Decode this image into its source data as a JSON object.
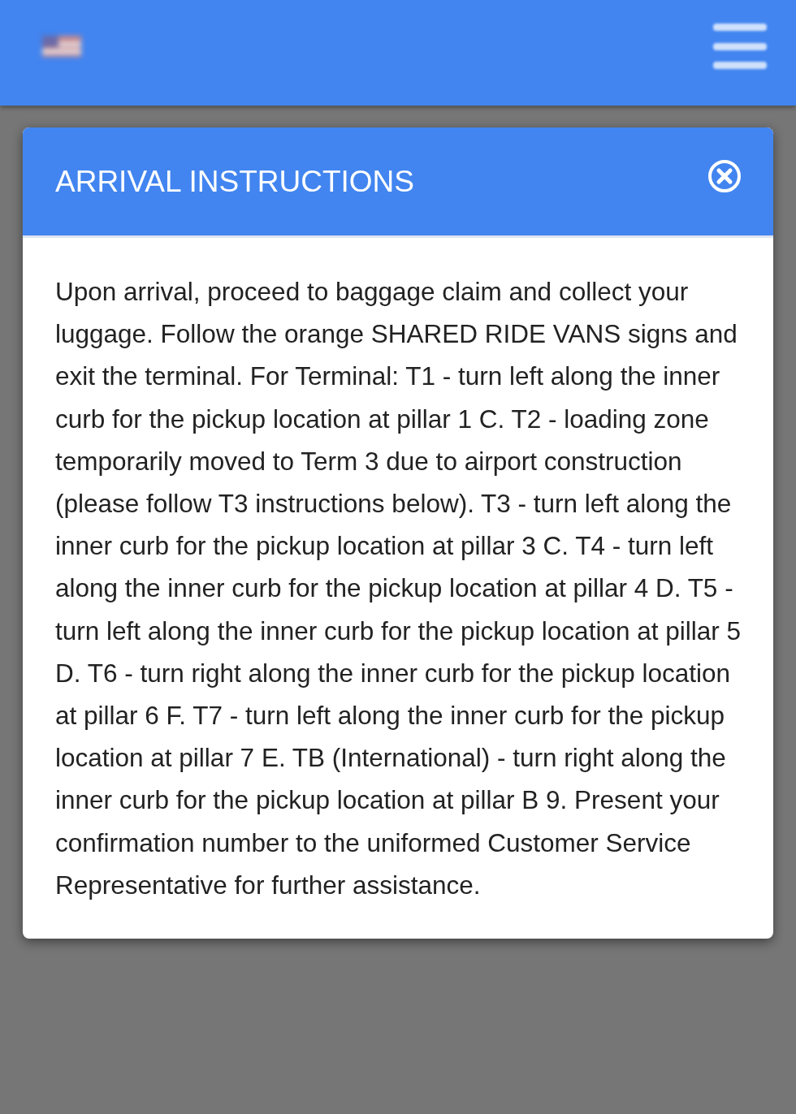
{
  "modal": {
    "title": "ARRIVAL INSTRUCTIONS",
    "body": "Upon arrival, proceed to baggage claim and collect your luggage. Follow the orange SHARED RIDE VANS signs and exit the terminal. For Terminal: T1 - turn left along the inner curb for the pickup location at pillar 1 C. T2 - loading zone temporarily moved to Term 3 due to airport construction (please follow T3 instructions below). T3 - turn left along the inner curb for the pickup location at pillar 3 C. T4 - turn left along the inner curb for the pickup location at pillar 4 D. T5 - turn left along the inner curb for the pickup location at pillar 5 D. T6 - turn right along the inner curb for the pickup location at pillar 6 F. T7 - turn left along the inner curb for the pickup location at pillar 7 E. TB (International) - turn right along the inner curb for the pickup location at pillar B 9. Present your confirmation number to the uniformed Customer Service Representative for further assistance."
  }
}
